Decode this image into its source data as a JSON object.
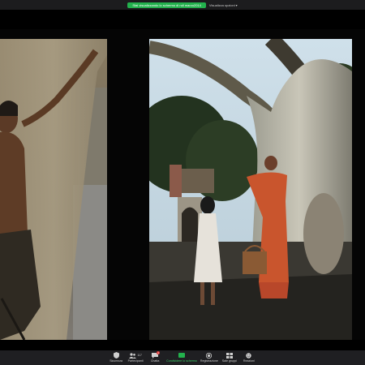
{
  "topbar": {
    "share_notice": "Stai visualizzando lo schermo di ndl marzo2014",
    "view_options": "Visualizza opzioni"
  },
  "toolbar": {
    "items": [
      {
        "label": "Sicurezza",
        "icon": "shield-icon"
      },
      {
        "label": "Partecipanti",
        "icon": "participants-icon",
        "count": "117"
      },
      {
        "label": "Chatta",
        "icon": "chat-icon",
        "badge": "1"
      },
      {
        "label": "Condividere lo schermo",
        "icon": "share-screen-icon",
        "color": "#3fd16a"
      },
      {
        "label": "Registrazione",
        "icon": "record-icon"
      },
      {
        "label": "Sale gruppi",
        "icon": "breakout-rooms-icon"
      },
      {
        "label": "Reazioni",
        "icon": "reactions-icon"
      }
    ]
  },
  "colors": {
    "share_green": "#23b14d",
    "toolbar_bg": "#1f1f22",
    "topbar_bg": "#1c1c1e"
  }
}
